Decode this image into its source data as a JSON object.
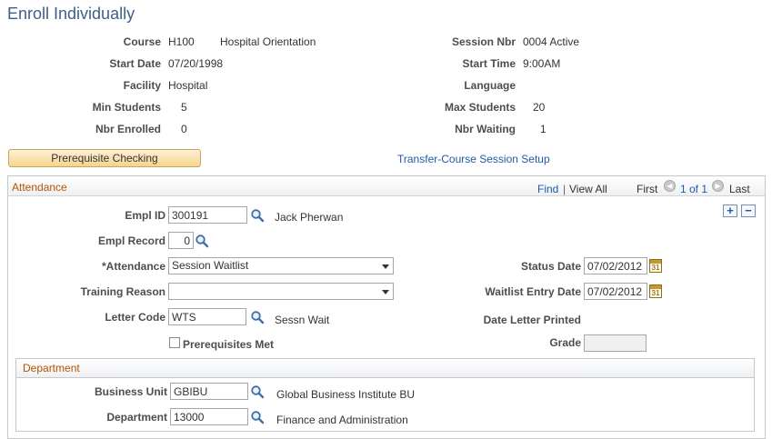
{
  "page": {
    "title": "Enroll Individually"
  },
  "header": {
    "course_label": "Course",
    "course_code": "H100",
    "course_name": "Hospital Orientation",
    "session_label": "Session Nbr",
    "session_value": "0004 Active",
    "start_date_label": "Start Date",
    "start_date_value": "07/20/1998",
    "start_time_label": "Start Time",
    "start_time_value": "9:00AM",
    "facility_label": "Facility",
    "facility_value": "Hospital",
    "language_label": "Language",
    "min_students_label": "Min Students",
    "min_students_value": "5",
    "max_students_label": "Max Students",
    "max_students_value": "20",
    "nbr_enrolled_label": "Nbr Enrolled",
    "nbr_enrolled_value": "0",
    "nbr_waiting_label": "Nbr Waiting",
    "nbr_waiting_value": "1"
  },
  "actions": {
    "prereq_button": "Prerequisite Checking",
    "transfer_link": "Transfer-Course Session Setup"
  },
  "attendance": {
    "title": "Attendance",
    "find": "Find",
    "separator": "|",
    "view_all": "View All",
    "first": "First",
    "page_info": "1 of 1",
    "last": "Last",
    "add_row": "+",
    "delete_row": "−",
    "empl_id_label": "Empl ID",
    "empl_id_value": "300191",
    "empl_name": "Jack Pherwan",
    "empl_record_label": "Empl Record",
    "empl_record_value": "0",
    "attendance_label": "*Attendance",
    "attendance_value": "Session Waitlist",
    "training_reason_label": "Training Reason",
    "training_reason_value": "",
    "letter_code_label": "Letter Code",
    "letter_code_value": "WTS",
    "letter_code_desc": "Sessn Wait",
    "prereq_met_label": "Prerequisites Met",
    "status_date_label": "Status Date",
    "status_date_value": "07/02/2012",
    "waitlist_date_label": "Waitlist Entry Date",
    "waitlist_date_value": "07/02/2012",
    "letter_printed_label": "Date Letter Printed",
    "grade_label": "Grade",
    "grade_value": "",
    "calendar_glyph": "31"
  },
  "department": {
    "title": "Department",
    "business_unit_label": "Business Unit",
    "business_unit_value": "GBIBU",
    "business_unit_desc": "Global Business Institute BU",
    "department_label": "Department",
    "department_value": "13000",
    "department_desc": "Finance and Administration"
  },
  "icons": {
    "lookup": "magnifier-icon",
    "calendar": "calendar-icon",
    "prev": "arrow-left-icon",
    "next": "arrow-right-icon"
  },
  "colors": {
    "title": "#3e5f8a",
    "section_title": "#b35400",
    "link": "#1f5aa8",
    "button": "#f6d48d"
  }
}
